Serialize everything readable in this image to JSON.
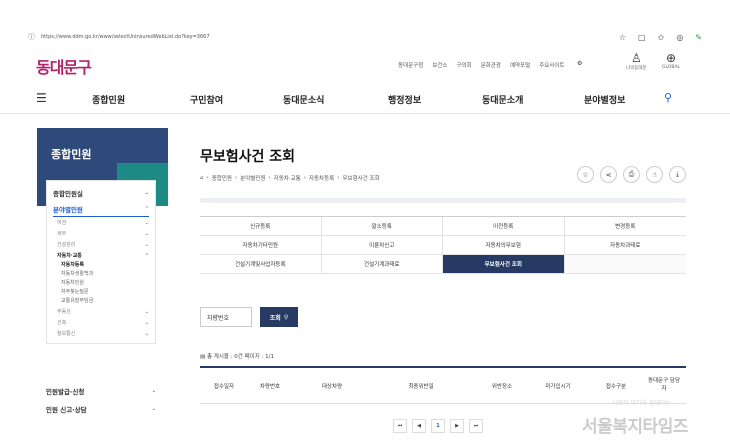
{
  "browser": {
    "url": "https://www.ddm.go.kr/www/selectUnInsuredWebList.do?key=3667"
  },
  "header": {
    "logo": "동대문구",
    "util_links": [
      "동대문구청",
      "보건소",
      "구의회",
      "문화관광",
      "예약포털",
      "주요사이트"
    ],
    "util_icons": [
      {
        "label": "나의동대문"
      },
      {
        "label": "GLOBAL"
      }
    ]
  },
  "nav": {
    "items": [
      "종합민원",
      "구민참여",
      "동대문소식",
      "행정정보",
      "동대문소개",
      "분야별정보"
    ]
  },
  "sidebar": {
    "title": "종합민원",
    "menu": [
      {
        "label": "종합민원실",
        "type": "main"
      },
      {
        "label": "분야별민원",
        "type": "main active"
      },
      {
        "label": "여권",
        "type": "sub"
      },
      {
        "label": "세무",
        "type": "sub"
      },
      {
        "label": "건설관리",
        "type": "sub"
      },
      {
        "label": "자동차·교통",
        "type": "sub bold"
      }
    ],
    "leaves": [
      "자동차등록",
      "자동차생활백과",
      "자동차민원",
      "자주찾는질문",
      "교통유발부담금"
    ],
    "after": [
      "부동산",
      "건축",
      "정보통신"
    ],
    "bottom": [
      "민원발급·신청",
      "민원 신고·상담"
    ]
  },
  "main": {
    "title": "무보험사건 조회",
    "breadcrumb": [
      "종합민원",
      "분야별민원",
      "자동차·교통",
      "자동차등록",
      "무보험사건 조회"
    ],
    "tabs": [
      "신규등록",
      "말소등록",
      "이전등록",
      "변경등록",
      "자동차기타민원",
      "이륜차신고",
      "자동차의무보험",
      "자동차과태료",
      "건설기계및사업자등록",
      "건설기계과태료",
      "무보험사건 조회",
      ""
    ],
    "active_tab": "무보험사건 조회",
    "search": {
      "select_value": "차량번호",
      "button_label": "조회"
    },
    "count_text": "총 게시물 : 0건  페이지 : 1/1",
    "table_headers": [
      "접수일자",
      "차량번호",
      "대상차량",
      "최종위반일",
      "위반장소",
      "미가입시기",
      "접수구분",
      "동대문구 담당자"
    ],
    "pager": [
      "⏮",
      "◀",
      "1",
      "▶",
      "⏭"
    ]
  },
  "watermark": {
    "main": "서울복지타임즈",
    "sub": "사회의 약자와 함께하는"
  },
  "colors": {
    "brand": "#b3226b",
    "navy": "#273a63",
    "accent": "#1f5ed6",
    "teal": "#1e8a86"
  }
}
